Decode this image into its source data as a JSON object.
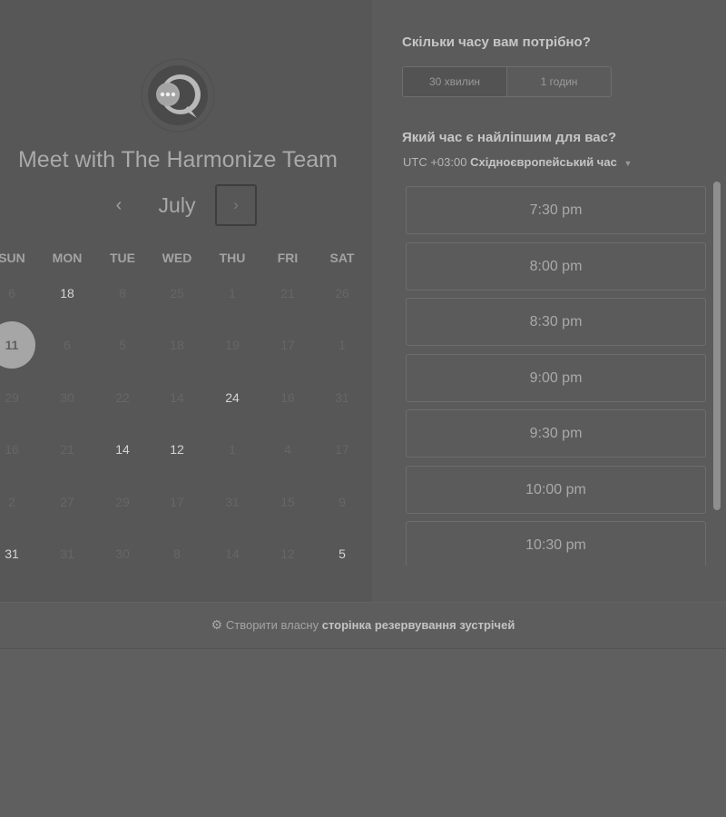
{
  "header": {
    "logo_icon": "chat-bubble-icon",
    "title": "Meet with The Harmonize Team"
  },
  "calendar": {
    "month": "July",
    "prev_icon": "‹",
    "next_icon": "›",
    "weekdays": [
      "SUN",
      "MON",
      "TUE",
      "WED",
      "THU",
      "FRI",
      "SAT"
    ],
    "weeks": [
      [
        {
          "d": "6",
          "s": "off"
        },
        {
          "d": "18",
          "s": "available"
        },
        {
          "d": "8",
          "s": "off"
        },
        {
          "d": "25",
          "s": "off"
        },
        {
          "d": "1",
          "s": "off"
        },
        {
          "d": "21",
          "s": "off"
        },
        {
          "d": "26",
          "s": "off"
        }
      ],
      [
        {
          "d": "11",
          "s": "selected"
        },
        {
          "d": "6",
          "s": "off"
        },
        {
          "d": "5",
          "s": "off"
        },
        {
          "d": "18",
          "s": "off"
        },
        {
          "d": "19",
          "s": "off"
        },
        {
          "d": "17",
          "s": "off"
        },
        {
          "d": "1",
          "s": "off"
        }
      ],
      [
        {
          "d": "29",
          "s": "off"
        },
        {
          "d": "30",
          "s": "off"
        },
        {
          "d": "22",
          "s": "off"
        },
        {
          "d": "14",
          "s": "off"
        },
        {
          "d": "24",
          "s": "available"
        },
        {
          "d": "16",
          "s": "off"
        },
        {
          "d": "31",
          "s": "off"
        }
      ],
      [
        {
          "d": "16",
          "s": "off"
        },
        {
          "d": "21",
          "s": "off"
        },
        {
          "d": "14",
          "s": "available"
        },
        {
          "d": "12",
          "s": "available"
        },
        {
          "d": "1",
          "s": "off"
        },
        {
          "d": "4",
          "s": "off"
        },
        {
          "d": "17",
          "s": "off"
        }
      ],
      [
        {
          "d": "2",
          "s": "off"
        },
        {
          "d": "27",
          "s": "off"
        },
        {
          "d": "29",
          "s": "off"
        },
        {
          "d": "17",
          "s": "off"
        },
        {
          "d": "31",
          "s": "off"
        },
        {
          "d": "15",
          "s": "off"
        },
        {
          "d": "9",
          "s": "off"
        }
      ],
      [
        {
          "d": "31",
          "s": "available"
        },
        {
          "d": "31",
          "s": "off"
        },
        {
          "d": "30",
          "s": "off"
        },
        {
          "d": "8",
          "s": "off"
        },
        {
          "d": "14",
          "s": "off"
        },
        {
          "d": "12",
          "s": "off"
        },
        {
          "d": "5",
          "s": "available"
        }
      ]
    ]
  },
  "booking": {
    "duration_question": "Скільки часу вам потрібно?",
    "durations": [
      {
        "label": "30 хвилин",
        "active": true
      },
      {
        "label": "1 годин",
        "active": false
      }
    ],
    "time_question": "Який час є найліпшим для вас?",
    "timezone_offset": "UTC +03:00",
    "timezone_name": "Східноєвропейський час",
    "timezone_caret": "▼",
    "slots": [
      "7:30 pm",
      "8:00 pm",
      "8:30 pm",
      "9:00 pm",
      "9:30 pm",
      "10:00 pm",
      "10:30 pm"
    ]
  },
  "footer": {
    "sprocket_icon": "hubspot-sprocket-icon",
    "text": "Створити власну",
    "link": "сторінка резервування зустрічей"
  }
}
